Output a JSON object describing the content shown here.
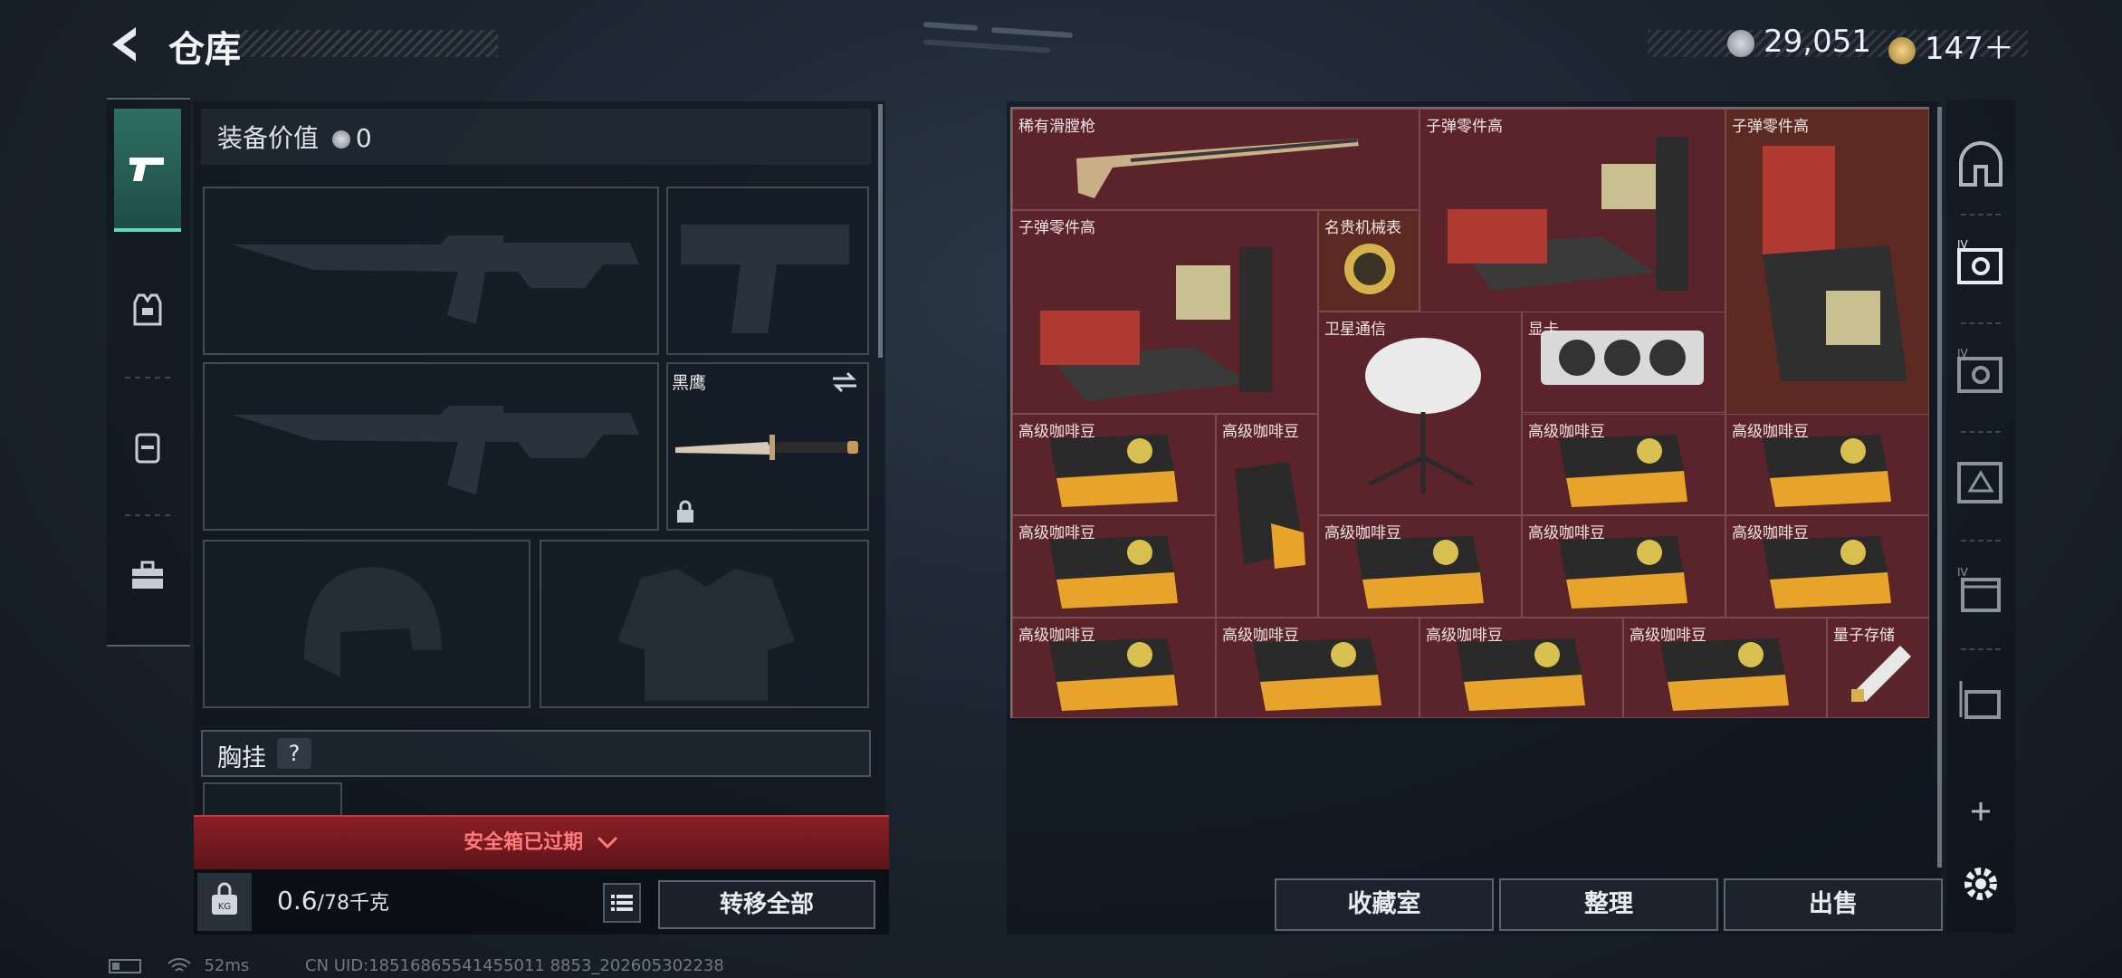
{
  "header": {
    "title": "仓库",
    "currency1": "29,051",
    "currency2": "147＋"
  },
  "left_tabs": [
    {
      "name": "weapons",
      "icon": "pistol-icon"
    },
    {
      "name": "armor",
      "icon": "vest-icon"
    },
    {
      "name": "backpack",
      "icon": "backpack-icon"
    },
    {
      "name": "case",
      "icon": "briefcase-icon"
    }
  ],
  "equipment": {
    "value_label": "装备价值",
    "value": "0",
    "knife_name": "黑鹰",
    "chest_label": "胸挂",
    "chest_help": "?"
  },
  "safe_box": {
    "status": "安全箱已过期"
  },
  "capacity": {
    "used": "0.6",
    "max": "/78千克"
  },
  "actions": {
    "move_all": "转移全部",
    "collection": "收藏室",
    "organize": "整理",
    "sell": "出售"
  },
  "inventory": {
    "items": [
      "稀有滑膛枪",
      "子弹零件高",
      "子弹零件高",
      "子弹零件高",
      "名贵机械表",
      "卫星通信",
      "显卡",
      "高级咖啡豆",
      "高级咖啡豆",
      "高级咖啡豆",
      "高级咖啡豆",
      "高级咖啡豆",
      "高级咖啡豆",
      "高级咖啡豆",
      "高级咖啡豆",
      "高级咖啡豆",
      "高级咖啡豆",
      "高级咖啡豆",
      "高级咖啡豆",
      "量子存储"
    ]
  },
  "status_bar": {
    "ping": "52ms",
    "uid": "CN UID:18516865541455011 8853_202605302238"
  }
}
